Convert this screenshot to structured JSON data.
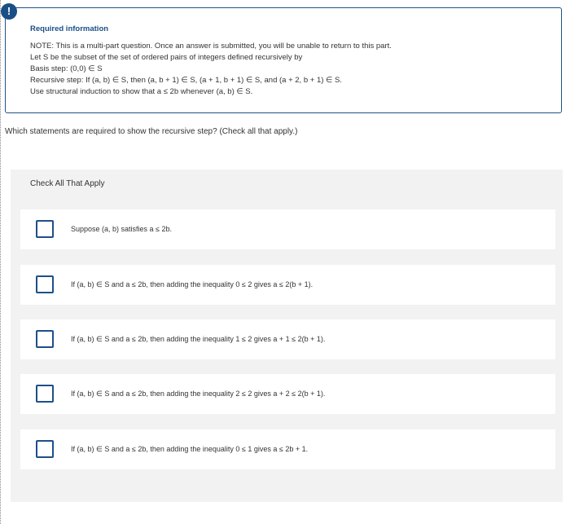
{
  "info": {
    "icon": "!",
    "title": "Required information",
    "lines": [
      "NOTE: This is a multi-part question. Once an answer is submitted, you will be unable to return to this part.",
      "Let S be the subset of the set of ordered pairs of integers defined recursively by",
      "Basis step: (0,0) ∈ S",
      "Recursive step: If (a, b) ∈ S, then (a, b + 1) ∈ S, (a + 1, b + 1) ∈ S, and (a + 2, b + 1) ∈ S.",
      "Use structural induction to show that a ≤ 2b whenever (a, b) ∈ S."
    ]
  },
  "question": "Which statements are required to show the recursive step? (Check all that apply.)",
  "panel": {
    "header": "Check All That Apply",
    "options": [
      "Suppose (a, b) satisfies a ≤ 2b.",
      "If (a, b) ∈ S and a ≤ 2b, then adding the inequality 0 ≤ 2 gives a ≤ 2(b + 1).",
      "If (a, b) ∈ S and a ≤ 2b, then adding the inequality 1 ≤ 2 gives a + 1 ≤ 2(b + 1).",
      "If (a, b) ∈ S and a ≤ 2b, then adding the inequality 2 ≤ 2 gives a + 2 ≤ 2(b + 1).",
      "If (a, b) ∈ S and a ≤ 2b, then adding the inequality 0 ≤ 1 gives a ≤ 2b + 1."
    ]
  },
  "colors": {
    "accent": "#1a4f86",
    "panel_bg": "#f2f2f2",
    "text": "#333333"
  }
}
